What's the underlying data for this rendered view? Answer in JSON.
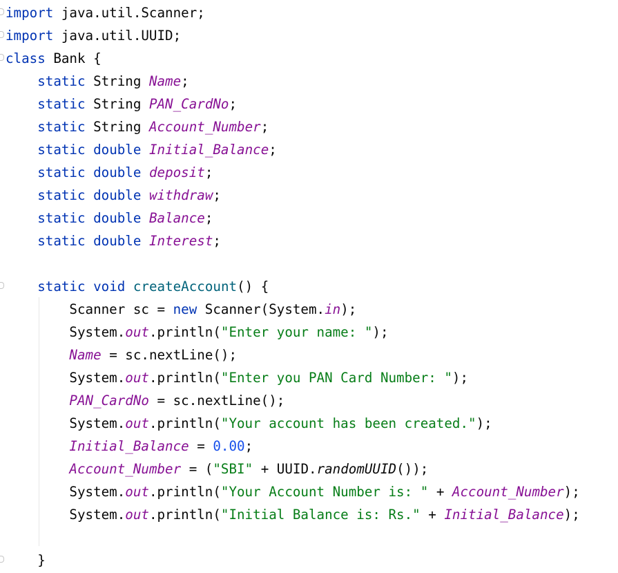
{
  "editor": {
    "lines": [
      [
        {
          "t": "import",
          "c": "kw"
        },
        {
          "t": " java.util.Scanner;",
          "c": "plain"
        }
      ],
      [
        {
          "t": "import",
          "c": "kw"
        },
        {
          "t": " java.util.UUID;",
          "c": "plain"
        }
      ],
      [
        {
          "t": "class",
          "c": "kw"
        },
        {
          "t": " Bank {",
          "c": "plain"
        }
      ],
      [
        {
          "t": "    ",
          "c": "plain"
        },
        {
          "t": "static",
          "c": "kw"
        },
        {
          "t": " String ",
          "c": "plain"
        },
        {
          "t": "Name",
          "c": "field"
        },
        {
          "t": ";",
          "c": "plain"
        }
      ],
      [
        {
          "t": "    ",
          "c": "plain"
        },
        {
          "t": "static",
          "c": "kw"
        },
        {
          "t": " String ",
          "c": "plain"
        },
        {
          "t": "PAN_CardNo",
          "c": "field"
        },
        {
          "t": ";",
          "c": "plain"
        }
      ],
      [
        {
          "t": "    ",
          "c": "plain"
        },
        {
          "t": "static",
          "c": "kw"
        },
        {
          "t": " String ",
          "c": "plain"
        },
        {
          "t": "Account_Number",
          "c": "field"
        },
        {
          "t": ";",
          "c": "plain"
        }
      ],
      [
        {
          "t": "    ",
          "c": "plain"
        },
        {
          "t": "static",
          "c": "kw"
        },
        {
          "t": " ",
          "c": "plain"
        },
        {
          "t": "double",
          "c": "kw"
        },
        {
          "t": " ",
          "c": "plain"
        },
        {
          "t": "Initial_Balance",
          "c": "field"
        },
        {
          "t": ";",
          "c": "plain"
        }
      ],
      [
        {
          "t": "    ",
          "c": "plain"
        },
        {
          "t": "static",
          "c": "kw"
        },
        {
          "t": " ",
          "c": "plain"
        },
        {
          "t": "double",
          "c": "kw"
        },
        {
          "t": " ",
          "c": "plain"
        },
        {
          "t": "deposit",
          "c": "field"
        },
        {
          "t": ";",
          "c": "plain"
        }
      ],
      [
        {
          "t": "    ",
          "c": "plain"
        },
        {
          "t": "static",
          "c": "kw"
        },
        {
          "t": " ",
          "c": "plain"
        },
        {
          "t": "double",
          "c": "kw"
        },
        {
          "t": " ",
          "c": "plain"
        },
        {
          "t": "withdraw",
          "c": "field"
        },
        {
          "t": ";",
          "c": "plain"
        }
      ],
      [
        {
          "t": "    ",
          "c": "plain"
        },
        {
          "t": "static",
          "c": "kw"
        },
        {
          "t": " ",
          "c": "plain"
        },
        {
          "t": "double",
          "c": "kw"
        },
        {
          "t": " ",
          "c": "plain"
        },
        {
          "t": "Balance",
          "c": "field"
        },
        {
          "t": ";",
          "c": "plain"
        }
      ],
      [
        {
          "t": "    ",
          "c": "plain"
        },
        {
          "t": "static",
          "c": "kw"
        },
        {
          "t": " ",
          "c": "plain"
        },
        {
          "t": "double",
          "c": "kw"
        },
        {
          "t": " ",
          "c": "plain"
        },
        {
          "t": "Interest",
          "c": "field"
        },
        {
          "t": ";",
          "c": "plain"
        }
      ],
      [],
      [
        {
          "t": "    ",
          "c": "plain"
        },
        {
          "t": "static",
          "c": "kw"
        },
        {
          "t": " ",
          "c": "plain"
        },
        {
          "t": "void",
          "c": "kw"
        },
        {
          "t": " ",
          "c": "plain"
        },
        {
          "t": "createAccount",
          "c": "fn"
        },
        {
          "t": "() {",
          "c": "plain"
        }
      ],
      [
        {
          "t": "        Scanner sc = ",
          "c": "plain"
        },
        {
          "t": "new",
          "c": "kw"
        },
        {
          "t": " Scanner(System.",
          "c": "plain"
        },
        {
          "t": "in",
          "c": "static-field"
        },
        {
          "t": ");",
          "c": "plain"
        }
      ],
      [
        {
          "t": "        System.",
          "c": "plain"
        },
        {
          "t": "out",
          "c": "static-field"
        },
        {
          "t": ".println(",
          "c": "plain"
        },
        {
          "t": "\"Enter your name: \"",
          "c": "str"
        },
        {
          "t": ");",
          "c": "plain"
        }
      ],
      [
        {
          "t": "        ",
          "c": "plain"
        },
        {
          "t": "Name",
          "c": "field"
        },
        {
          "t": " = sc.nextLine();",
          "c": "plain"
        }
      ],
      [
        {
          "t": "        System.",
          "c": "plain"
        },
        {
          "t": "out",
          "c": "static-field"
        },
        {
          "t": ".println(",
          "c": "plain"
        },
        {
          "t": "\"Enter you PAN Card Number: \"",
          "c": "str"
        },
        {
          "t": ");",
          "c": "plain"
        }
      ],
      [
        {
          "t": "        ",
          "c": "plain"
        },
        {
          "t": "PAN_CardNo",
          "c": "field"
        },
        {
          "t": " = sc.nextLine();",
          "c": "plain"
        }
      ],
      [
        {
          "t": "        System.",
          "c": "plain"
        },
        {
          "t": "out",
          "c": "static-field"
        },
        {
          "t": ".println(",
          "c": "plain"
        },
        {
          "t": "\"Your account has been created.\"",
          "c": "str"
        },
        {
          "t": ");",
          "c": "plain"
        }
      ],
      [
        {
          "t": "        ",
          "c": "plain"
        },
        {
          "t": "Initial_Balance",
          "c": "field"
        },
        {
          "t": " = ",
          "c": "plain"
        },
        {
          "t": "0.00",
          "c": "num"
        },
        {
          "t": ";",
          "c": "plain"
        }
      ],
      [
        {
          "t": "        ",
          "c": "plain"
        },
        {
          "t": "Account_Number",
          "c": "field"
        },
        {
          "t": " = (",
          "c": "plain"
        },
        {
          "t": "\"SBI\"",
          "c": "str"
        },
        {
          "t": " + UUID.",
          "c": "plain"
        },
        {
          "t": "randomUUID",
          "c": "static-call"
        },
        {
          "t": "());",
          "c": "plain"
        }
      ],
      [
        {
          "t": "        System.",
          "c": "plain"
        },
        {
          "t": "out",
          "c": "static-field"
        },
        {
          "t": ".println(",
          "c": "plain"
        },
        {
          "t": "\"Your Account Number is: \"",
          "c": "str"
        },
        {
          "t": " + ",
          "c": "plain"
        },
        {
          "t": "Account_Number",
          "c": "field"
        },
        {
          "t": ");",
          "c": "plain"
        }
      ],
      [
        {
          "t": "        System.",
          "c": "plain"
        },
        {
          "t": "out",
          "c": "static-field"
        },
        {
          "t": ".println(",
          "c": "plain"
        },
        {
          "t": "\"Initial Balance is: Rs.\"",
          "c": "str"
        },
        {
          "t": " + ",
          "c": "plain"
        },
        {
          "t": "Initial_Balance",
          "c": "field"
        },
        {
          "t": ");",
          "c": "plain"
        }
      ],
      [],
      [
        {
          "t": "    }",
          "c": "plain"
        }
      ]
    ]
  }
}
